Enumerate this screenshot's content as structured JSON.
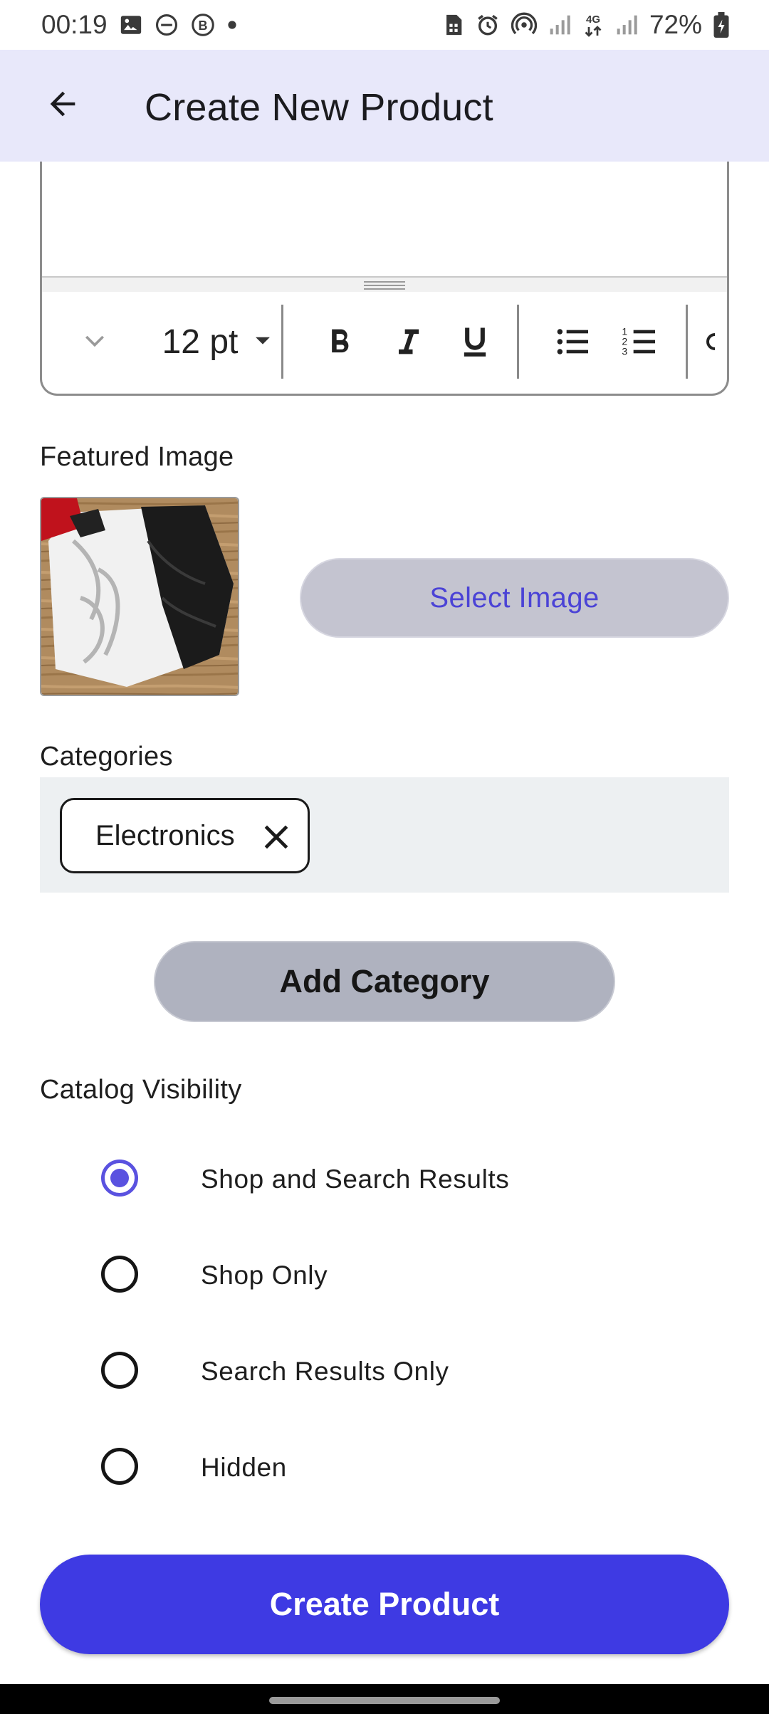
{
  "status_bar": {
    "time": "00:19",
    "battery": "72%",
    "network": "4G"
  },
  "app_bar": {
    "title": "Create New Product",
    "back_icon": "arrow-back-icon"
  },
  "editor": {
    "font_size": "12 pt",
    "tools": [
      "chevron-down-icon",
      "dropdown-icon",
      "bold-icon",
      "italic-icon",
      "underline-icon",
      "bullet-list-icon",
      "numbered-list-icon"
    ]
  },
  "featured_image": {
    "label": "Featured Image",
    "select_button": "Select Image"
  },
  "categories": {
    "label": "Categories",
    "chips": [
      "Electronics"
    ],
    "add_button": "Add Category"
  },
  "visibility": {
    "label": "Catalog Visibility",
    "options": [
      {
        "label": "Shop and Search Results",
        "selected": true
      },
      {
        "label": "Shop Only",
        "selected": false
      },
      {
        "label": "Search Results Only",
        "selected": false
      },
      {
        "label": "Hidden",
        "selected": false
      }
    ]
  },
  "submit": {
    "label": "Create Product"
  },
  "colors": {
    "accent": "#3e3ae3",
    "app_bar": "#e8e8fa",
    "radio_selected": "#5a52e0"
  }
}
